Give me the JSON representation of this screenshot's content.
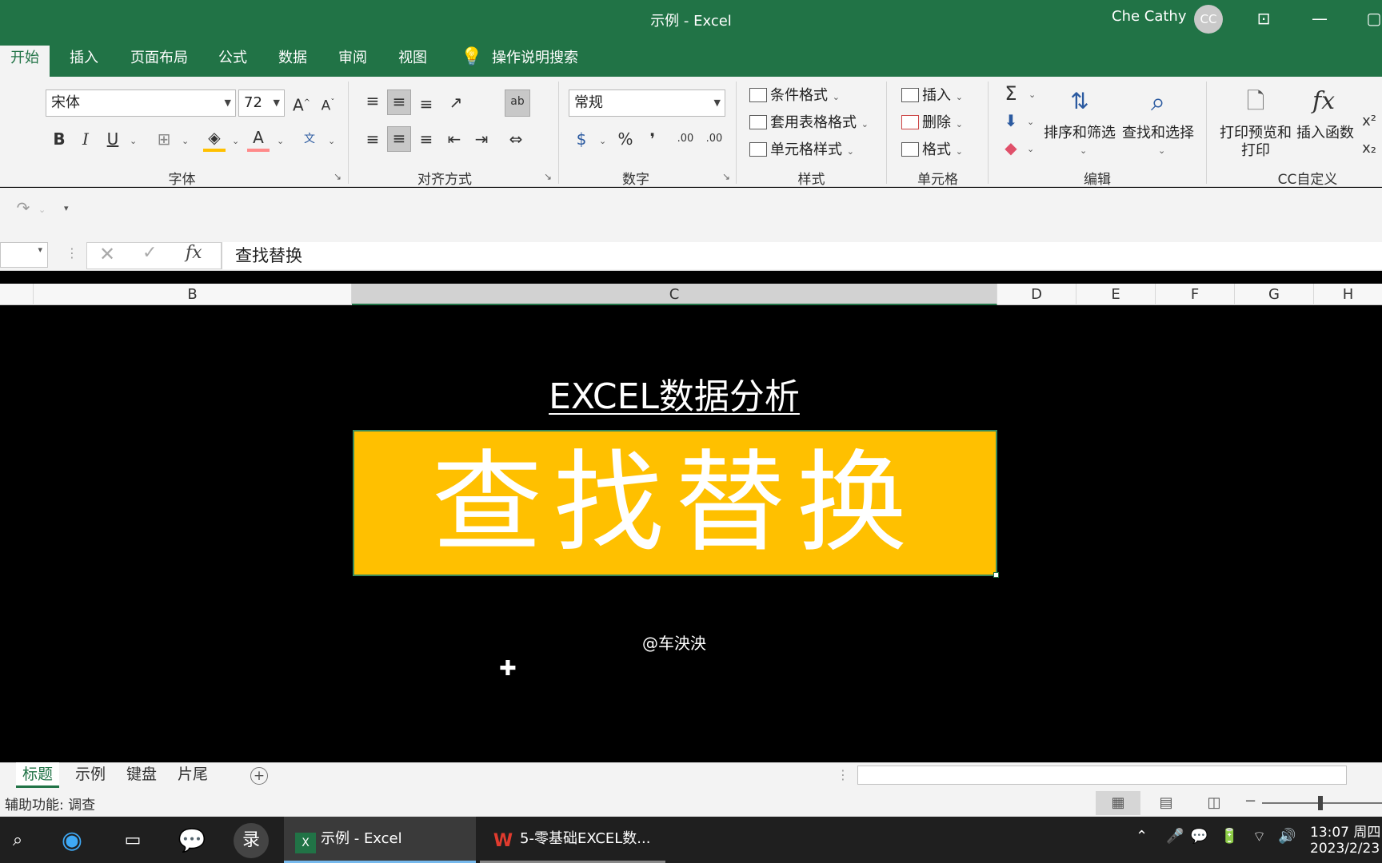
{
  "window": {
    "title": "示例  -  Excel",
    "user_name": "Che Cathy",
    "user_initials": "CC"
  },
  "ribbon_tabs": [
    "开始",
    "插入",
    "页面布局",
    "公式",
    "数据",
    "审阅",
    "视图"
  ],
  "tell_me": "操作说明搜索",
  "font_group": {
    "font_name": "宋体",
    "font_size": "72",
    "label": "字体"
  },
  "align_group": {
    "label": "对齐方式"
  },
  "number_group": {
    "format": "常规",
    "label": "数字",
    "percent": "%",
    "comma": "❜",
    "inc_dec": ".00",
    "dec_dec": ".00"
  },
  "styles_group": {
    "conditional": "条件格式",
    "table": "套用表格格式",
    "cell": "单元格样式",
    "label": "样式"
  },
  "cells_group": {
    "insert": "插入",
    "delete": "删除",
    "format": "格式",
    "label": "单元格"
  },
  "editing_group": {
    "sort": "排序和筛选",
    "find": "查找和选择",
    "label": "编辑"
  },
  "custom_group": {
    "print_preview_1": "打印预览和",
    "print_preview_2": "打印",
    "insert_function": "插入函数",
    "label": "CC自定义"
  },
  "formula_bar": {
    "content": "查找替换"
  },
  "columns": [
    "B",
    "C",
    "D",
    "E",
    "F",
    "G",
    "H"
  ],
  "sheet": {
    "heading": "EXCEL数据分析",
    "banner": "查找替换",
    "credit": "@车泱泱"
  },
  "sheet_tabs": [
    "标题",
    "示例",
    "键盘",
    "片尾"
  ],
  "status": {
    "accessibility": "辅助功能: 调查"
  },
  "taskbar": {
    "apps": [
      "示例 - Excel",
      "5-零基础EXCEL数..."
    ],
    "record_label": "录",
    "time": "13:07 周四",
    "date": "2023/2/23"
  },
  "colors": {
    "excel_green": "#217346",
    "banner_fill": "#ffc000"
  }
}
